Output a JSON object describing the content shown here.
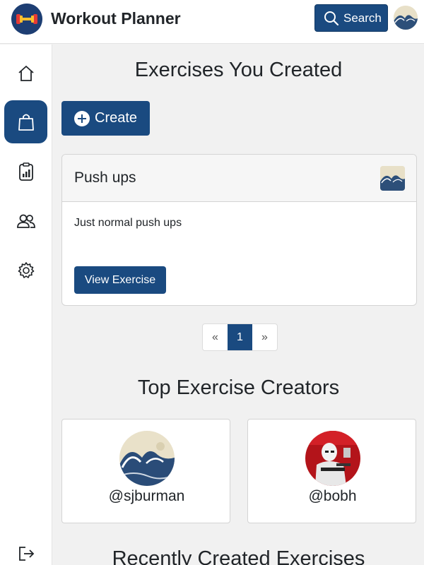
{
  "header": {
    "app_title": "Workout Planner",
    "search_label": "Search",
    "brand_color": "#1a4a80"
  },
  "sidebar": {
    "items": [
      {
        "icon": "home-icon"
      },
      {
        "icon": "shopping-bag-icon",
        "active": true
      },
      {
        "icon": "clipboard-chart-icon"
      },
      {
        "icon": "people-icon"
      },
      {
        "icon": "gear-icon"
      },
      {
        "icon": "logout-icon"
      }
    ]
  },
  "main": {
    "created_title": "Exercises You Created",
    "create_label": "Create",
    "exercises": [
      {
        "title": "Push ups",
        "description": "Just normal push ups",
        "button_label": "View Exercise"
      }
    ],
    "pagination": {
      "prev": "«",
      "current": "1",
      "next": "»"
    },
    "creators_title": "Top Exercise Creators",
    "creators": [
      {
        "username": "@sjburman"
      },
      {
        "username": "@bobh"
      }
    ],
    "recent_title": "Recently Created Exercises"
  }
}
